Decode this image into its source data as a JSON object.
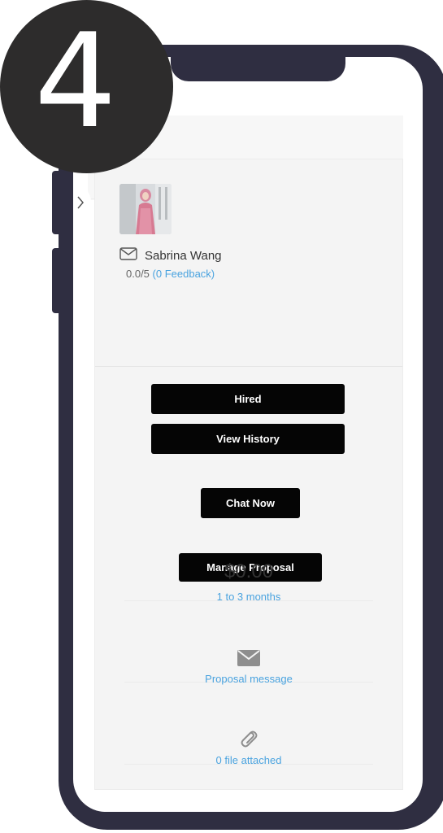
{
  "step_badge": {
    "number": "4"
  },
  "seller": {
    "name": "Sabrina Wang",
    "rating": "0.0/5",
    "feedback": "(0 Feedback)"
  },
  "actions": {
    "hired": "Hired",
    "view_history": "View History",
    "chat_now": "Chat Now",
    "manage_proposal": "Manage Proposal"
  },
  "proposal": {
    "price": "$0.00",
    "duration": "1 to 3 months",
    "message_link": "Proposal message",
    "attachments": "0 file attached"
  },
  "colors": {
    "frame": "#2f2e41",
    "button": "#050505",
    "link": "#4aa3df",
    "badge": "#2d2c2c"
  },
  "icons": [
    "envelope-icon",
    "mail-icon",
    "paperclip-icon",
    "chevron-right-icon"
  ]
}
